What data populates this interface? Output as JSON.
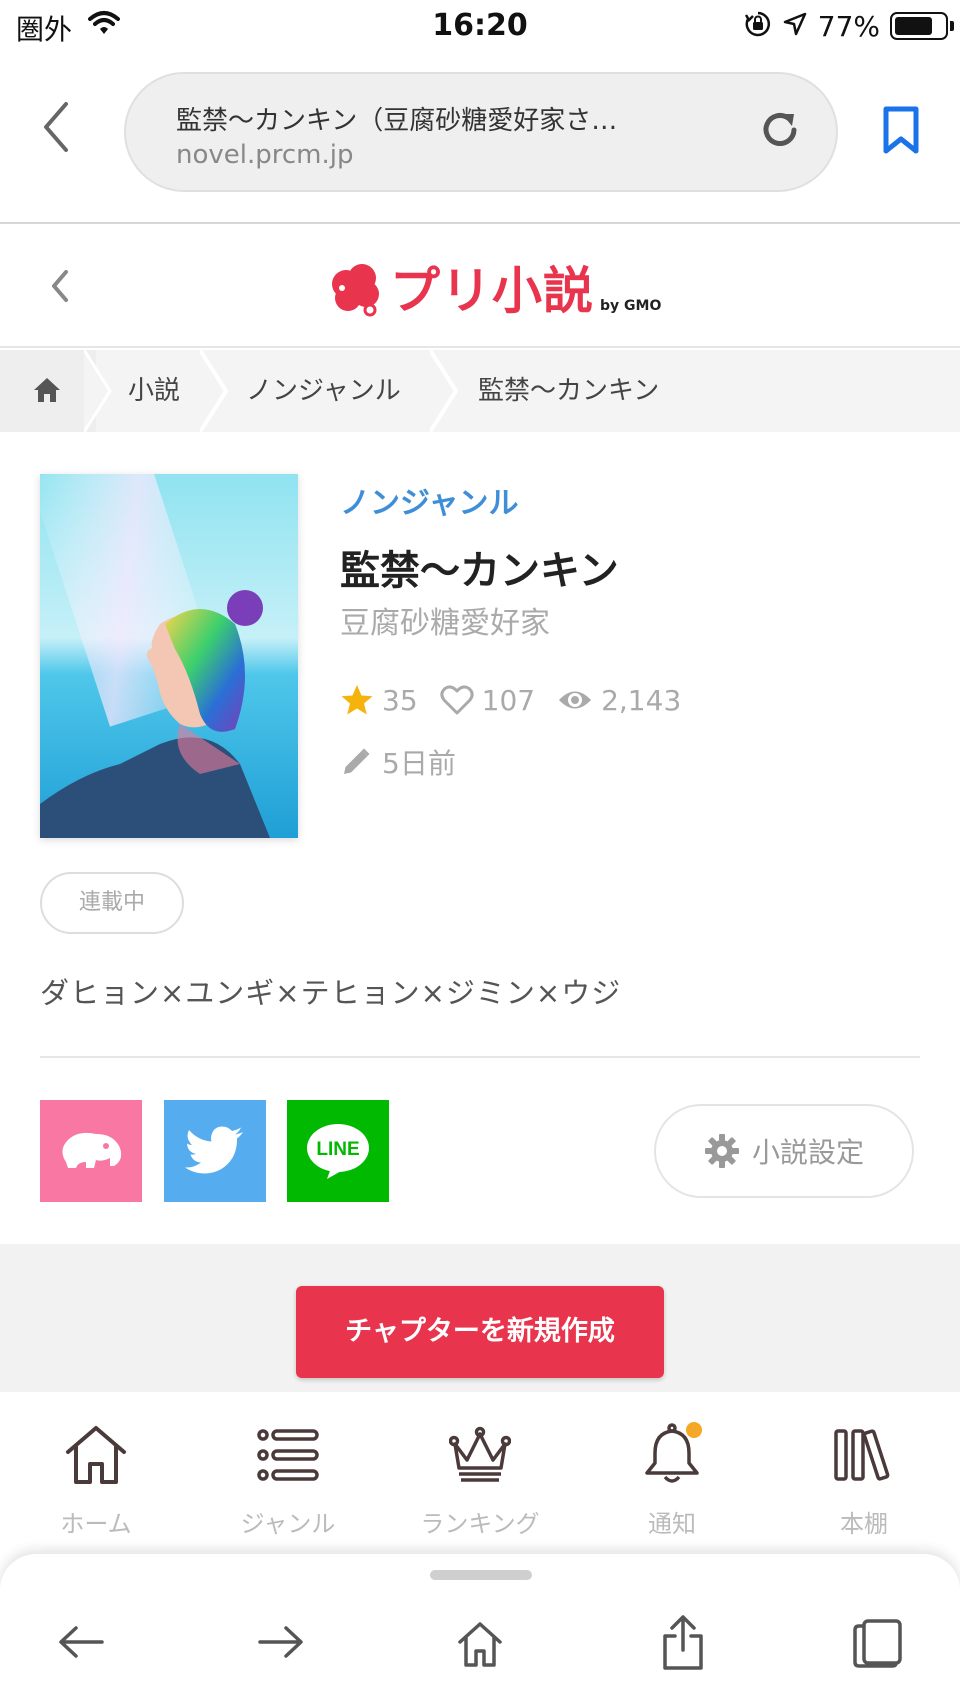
{
  "status_bar": {
    "carrier": "圏外",
    "time": "16:20",
    "battery_percent": "77%",
    "battery_level": 0.77,
    "icons": [
      "wifi-icon",
      "rotation-lock-icon",
      "location-arrow-icon",
      "battery-icon"
    ]
  },
  "browser": {
    "page_title": "監禁〜カンキン（豆腐砂糖愛好家さ…",
    "host": "novel.prcm.jp",
    "accent_color": "#1a73e8"
  },
  "site": {
    "logo_text": "プリ小説",
    "logo_suffix": "by GMO",
    "brand_color": "#e8344d"
  },
  "breadcrumb": {
    "items": [
      "小説",
      "ノンジャンル",
      "監禁〜カンキン"
    ]
  },
  "novel": {
    "genre": "ノンジャンル",
    "title": "監禁〜カンキン",
    "author": "豆腐砂糖愛好家",
    "stars": "35",
    "likes": "107",
    "views": "2,143",
    "updated": "5日前",
    "status": "連載中",
    "description": "ダヒョン×ユンギ×テヒョン×ジミン×ウジ"
  },
  "share": {
    "line_label": "LINE",
    "settings_label": "小説設定"
  },
  "actions": {
    "create_chapter": "チャプターを新規作成"
  },
  "app_nav": {
    "items": [
      {
        "label": "ホーム",
        "icon": "home-icon"
      },
      {
        "label": "ジャンル",
        "icon": "list-icon"
      },
      {
        "label": "ランキング",
        "icon": "crown-icon"
      },
      {
        "label": "通知",
        "icon": "bell-icon"
      },
      {
        "label": "本棚",
        "icon": "bookshelf-icon"
      }
    ]
  }
}
